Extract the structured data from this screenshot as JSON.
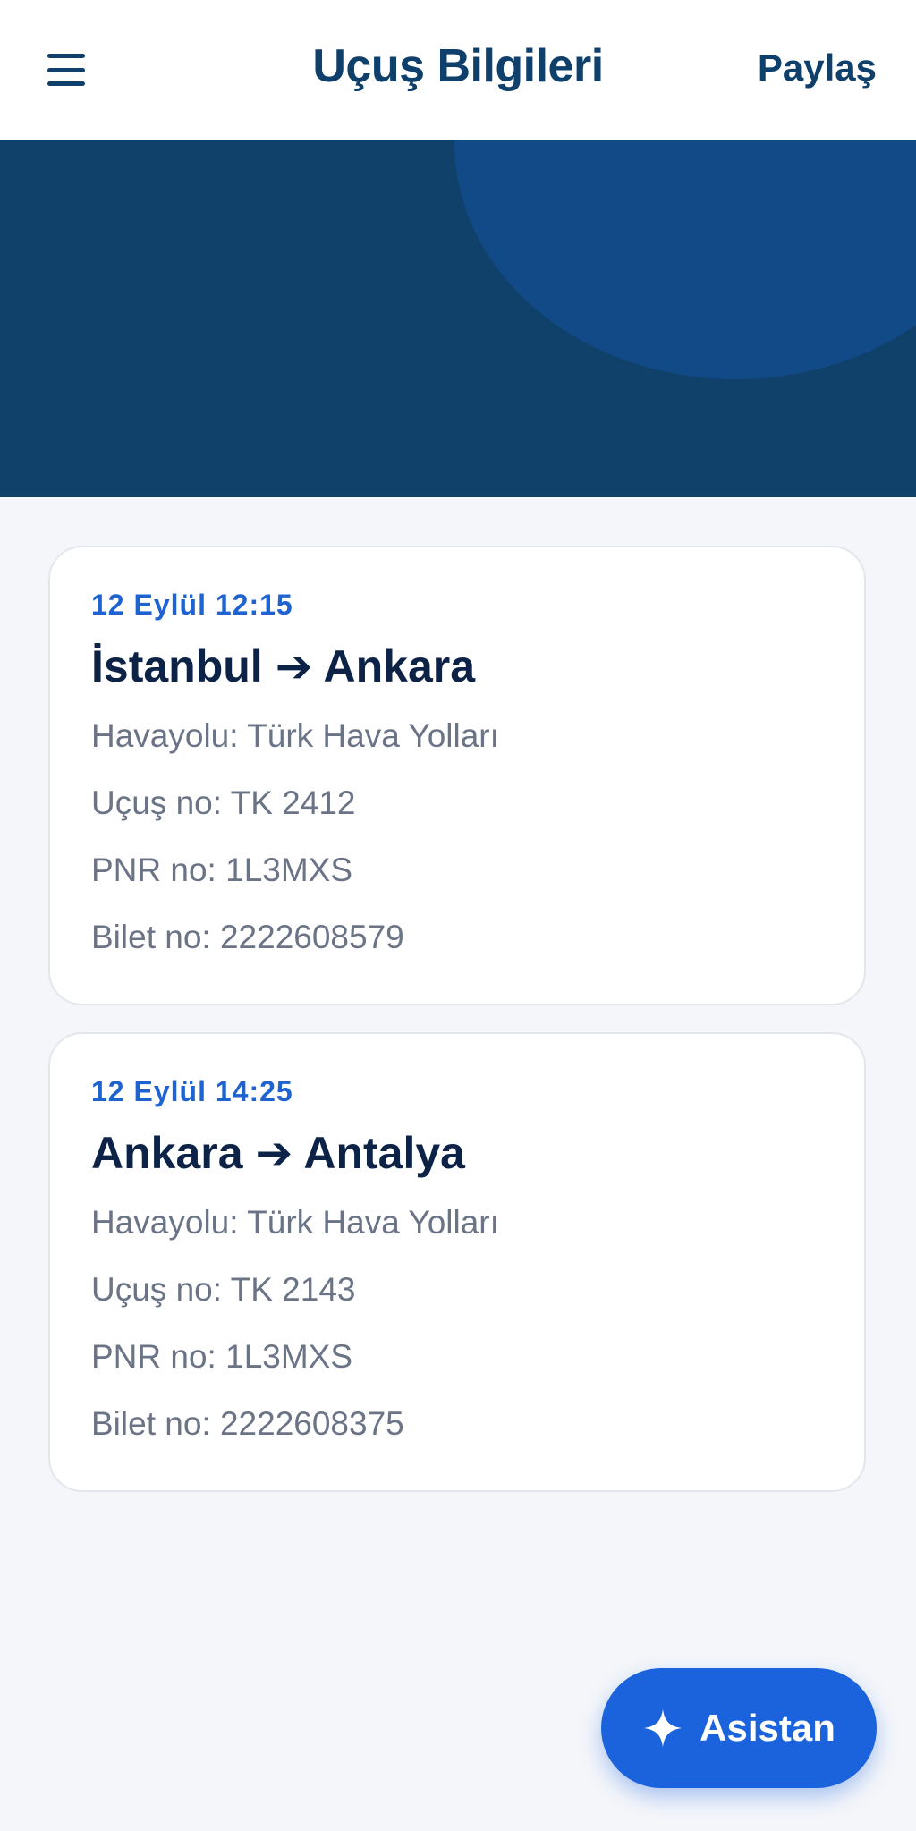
{
  "header": {
    "title": "Uçuş Bilgileri",
    "share_label": "Paylaş",
    "menu_icon": "hamburger-menu-icon"
  },
  "colors": {
    "primary_dark": "#0f3f6b",
    "hero_background": "#0f416b",
    "hero_circle": "#124a87",
    "accent_blue": "#1f63d1",
    "button_blue": "#1a63dc",
    "route_text": "#0c2347",
    "detail_text": "#6b7486",
    "page_background": "#f5f6fa"
  },
  "flights": [
    {
      "date_time": "12 Eylül 12:15",
      "route": "İstanbul ➔ Ankara",
      "airline": "Havayolu: Türk Hava Yolları",
      "flight_no": "Uçuş no: TK 2412",
      "pnr": "PNR no: 1L3MXS",
      "ticket": "Bilet no: 2222608579"
    },
    {
      "date_time": "12 Eylül 14:25",
      "route": "Ankara ➔ Antalya",
      "airline": "Havayolu: Türk Hava Yolları",
      "flight_no": "Uçuş no: TK 2143",
      "pnr": "PNR no: 1L3MXS",
      "ticket": "Bilet no: 2222608375"
    }
  ],
  "assistant_button": {
    "label": "Asistan",
    "icon": "sparkle-icon"
  }
}
